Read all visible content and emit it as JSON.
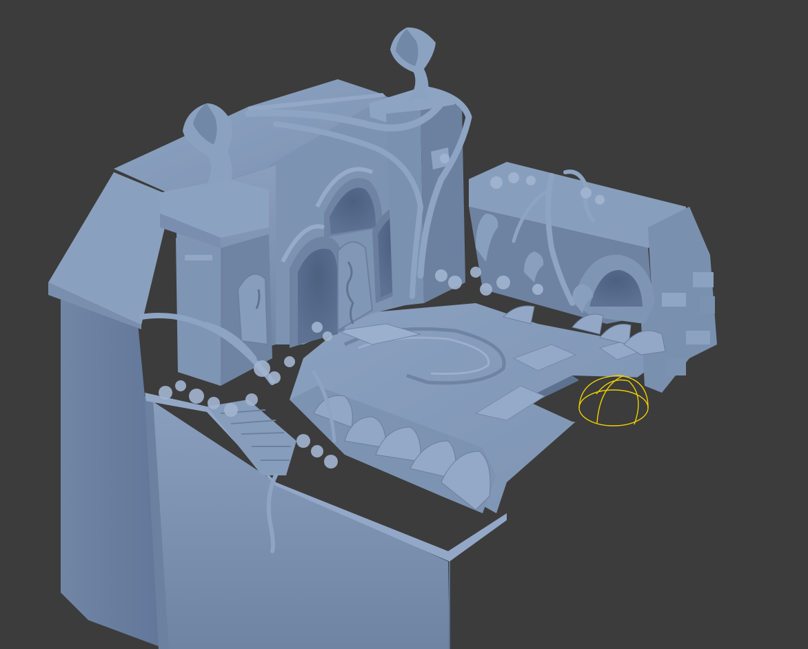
{
  "viewport": {
    "background": "#3c3c3c",
    "shading": "clay-render",
    "model_color": "#7f95b3"
  },
  "scene": {
    "subject": "ruined-temple-courtyard",
    "objects": [
      "left-cobra-statue",
      "center-cobra-statue",
      "arched-doorways",
      "carved-door-panels",
      "tree-roots",
      "foliage",
      "courtyard-floor",
      "circular-floor-inlay",
      "crenellated-parapet",
      "right-broken-wall",
      "right-arch",
      "small-cobra-heads",
      "stairway",
      "base-plinth"
    ]
  },
  "selection": {
    "object": "light-gizmo",
    "gizmo": "hemisphere-wireframe",
    "color": "#f0d000"
  }
}
